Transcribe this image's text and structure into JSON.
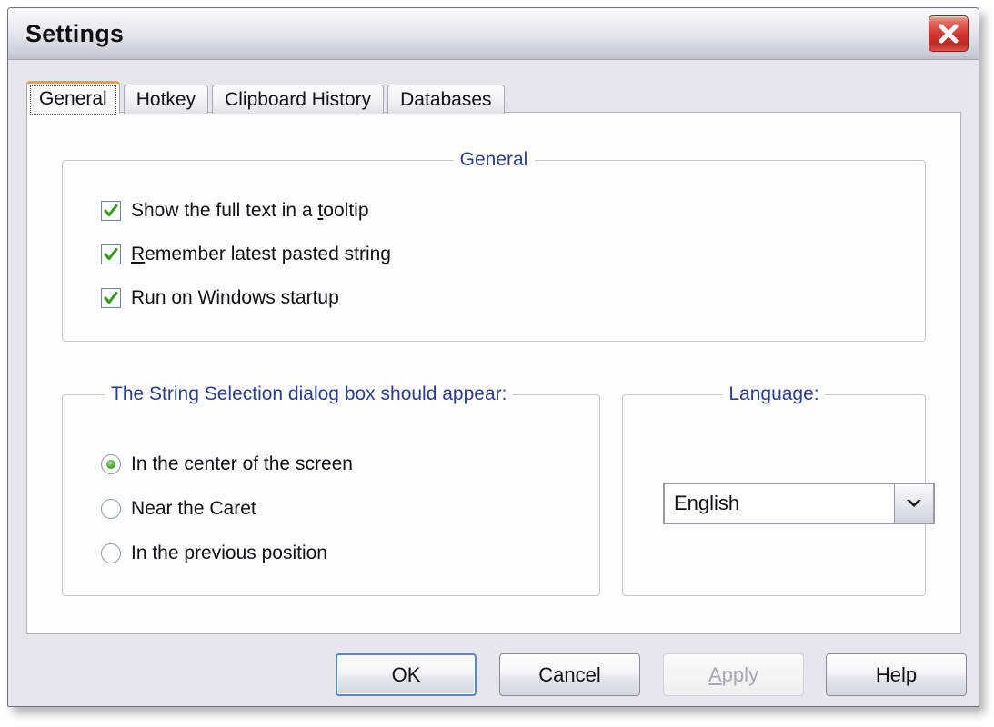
{
  "window": {
    "title": "Settings",
    "close_icon": "close-x-icon"
  },
  "tabs": [
    {
      "label": "General",
      "selected": true
    },
    {
      "label": "Hotkey",
      "selected": false
    },
    {
      "label": "Clipboard History",
      "selected": false
    },
    {
      "label": "Databases",
      "selected": false
    }
  ],
  "general_group": {
    "legend": "General",
    "checkboxes": [
      {
        "label_before": "Show the full text in a ",
        "accelerator": "t",
        "label_after": "ooltip",
        "checked": true
      },
      {
        "label_before": "",
        "accelerator": "R",
        "label_after": "emember latest pasted string",
        "checked": true
      },
      {
        "label_before": "Run on Windows startup",
        "accelerator": "",
        "label_after": "",
        "checked": true
      }
    ]
  },
  "position_group": {
    "legend": "The String Selection dialog box should appear:",
    "radios": [
      {
        "label": "In the center of the screen",
        "selected": true
      },
      {
        "label": "Near the Caret",
        "selected": false
      },
      {
        "label": "In the previous position",
        "selected": false
      }
    ]
  },
  "language_group": {
    "legend": "Language:",
    "combo": {
      "value": "English",
      "arrow_icon": "chevron-down-icon"
    }
  },
  "footer": {
    "buttons": [
      {
        "label": "OK",
        "accelerator": "",
        "state": "default"
      },
      {
        "label": "Cancel",
        "accelerator": "",
        "state": "normal"
      },
      {
        "label_before": "",
        "accelerator": "A",
        "label_after": "pply",
        "label": "Apply",
        "state": "disabled"
      },
      {
        "label": "Help",
        "accelerator": "",
        "state": "normal"
      }
    ]
  },
  "colors": {
    "accent_legend": "#2b3e8c",
    "tab_selected_top": "#f0a22e",
    "close_button": "#cf352c",
    "check_green": "#49a52b",
    "default_button_border": "#5a86c4",
    "dialog_background": "#e6e6ec",
    "panel_background": "#fdfdfd"
  }
}
